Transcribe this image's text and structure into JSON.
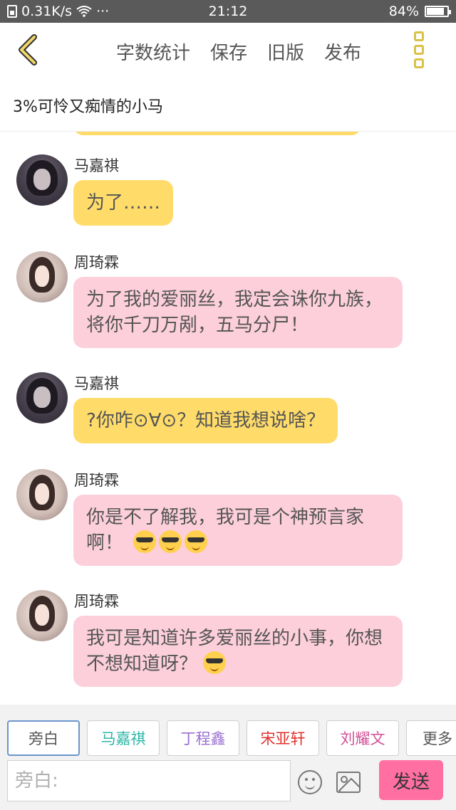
{
  "status_bar": {
    "speed": "0.31K/s",
    "dots": "···",
    "time": "21:12",
    "battery": "84%"
  },
  "toolbar": {
    "items": [
      "字数统计",
      "保存",
      "旧版",
      "发布"
    ]
  },
  "title": "3%可怜又痴情的小马",
  "messages": [
    {
      "name": "马嘉祺",
      "text": "为了……",
      "color": "#ffdc6a",
      "emoji_count": 0
    },
    {
      "name": "周琦霖",
      "text": "为了我的爱丽丝，我定会诛你九族，将你千刀万剐，五马分尸！",
      "color": "#fccfdb",
      "emoji_count": 0
    },
    {
      "name": "马嘉祺",
      "text": "?你咋⊙∀⊙？知道我想说啥？",
      "color": "#ffdc6a",
      "emoji_count": 0
    },
    {
      "name": "周琦霖",
      "text": "你是不了解我，我可是个神预言家啊！",
      "color": "#fccfdb",
      "emoji_count": 3
    },
    {
      "name": "周琦霖",
      "text": "我可是知道许多爱丽丝的小事，你想不想知道呀？",
      "color": "#fccfdb",
      "emoji_count": 1
    }
  ],
  "chips": [
    {
      "label": "旁白",
      "color": "#555555"
    },
    {
      "label": "马嘉祺",
      "color": "#2bb5a8"
    },
    {
      "label": "丁程鑫",
      "color": "#9b6fd0"
    },
    {
      "label": "宋亚轩",
      "color": "#e0302c"
    },
    {
      "label": "刘耀文",
      "color": "#d04f96"
    },
    {
      "label": "更多",
      "color": "#555555"
    }
  ],
  "input": {
    "placeholder": "旁白:"
  },
  "send_label": "发送",
  "icons": {
    "back": "chevron-left-icon",
    "more": "more-vertical-icon",
    "emoji": "smiley-icon",
    "image": "image-icon",
    "wifi": "wifi-icon",
    "battery": "battery-icon"
  },
  "colors": {
    "accent": "#d9c246",
    "yellow_bubble": "#ffdc6a",
    "pink_bubble": "#fccfdb",
    "send": "#ff6fa1"
  }
}
